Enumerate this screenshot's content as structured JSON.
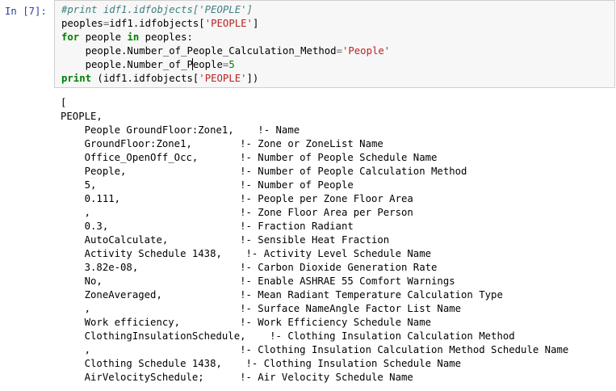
{
  "cell": {
    "prompt": "In [7]:",
    "code": [
      [
        {
          "t": "#print idf1.idfobjects['PEOPLE']",
          "c": "cm"
        }
      ],
      [
        {
          "t": "peoples",
          "c": ""
        },
        {
          "t": "=",
          "c": "op"
        },
        {
          "t": "idf1.idfobjects[",
          "c": ""
        },
        {
          "t": "'PEOPLE'",
          "c": "str"
        },
        {
          "t": "]",
          "c": ""
        }
      ],
      [
        {
          "t": "for",
          "c": "kw"
        },
        {
          "t": " people ",
          "c": ""
        },
        {
          "t": "in",
          "c": "kw"
        },
        {
          "t": " peoples:",
          "c": ""
        }
      ],
      [
        {
          "t": "    people.Number_of_People_Calculation_Method",
          "c": ""
        },
        {
          "t": "=",
          "c": "op"
        },
        {
          "t": "'People'",
          "c": "str"
        }
      ],
      [
        {
          "t": "    people.Number_of_P",
          "c": ""
        },
        {
          "t": "|",
          "c": "cursor"
        },
        {
          "t": "eople",
          "c": ""
        },
        {
          "t": "=",
          "c": "op"
        },
        {
          "t": "5",
          "c": "num"
        }
      ],
      [
        {
          "t": "print",
          "c": "kw"
        },
        {
          "t": " (idf1.idfobjects[",
          "c": ""
        },
        {
          "t": "'PEOPLE'",
          "c": "str"
        },
        {
          "t": "])",
          "c": ""
        }
      ]
    ]
  },
  "output": [
    "[",
    "PEOPLE,",
    "    People GroundFloor:Zone1,    !- Name",
    "    GroundFloor:Zone1,        !- Zone or ZoneList Name",
    "    Office_OpenOff_Occ,       !- Number of People Schedule Name",
    "    People,                   !- Number of People Calculation Method",
    "    5,                        !- Number of People",
    "    0.111,                    !- People per Zone Floor Area",
    "    ,                         !- Zone Floor Area per Person",
    "    0.3,                      !- Fraction Radiant",
    "    AutoCalculate,            !- Sensible Heat Fraction",
    "    Activity Schedule 1438,    !- Activity Level Schedule Name",
    "    3.82e-08,                 !- Carbon Dioxide Generation Rate",
    "    No,                       !- Enable ASHRAE 55 Comfort Warnings",
    "    ZoneAveraged,             !- Mean Radiant Temperature Calculation Type",
    "    ,                         !- Surface NameAngle Factor List Name",
    "    Work efficiency,          !- Work Efficiency Schedule Name",
    "    ClothingInsulationSchedule,    !- Clothing Insulation Calculation Method",
    "    ,                         !- Clothing Insulation Calculation Method Schedule Name",
    "    Clothing Schedule 1438,    !- Clothing Insulation Schedule Name",
    "    AirVelocitySchedule;      !- Air Velocity Schedule Name"
  ]
}
